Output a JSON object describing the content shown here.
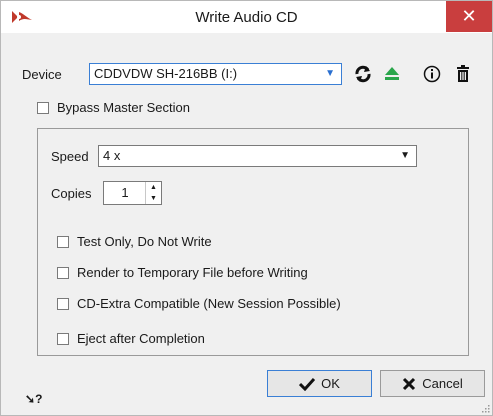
{
  "window": {
    "title": "Write Audio CD",
    "close_label": "✕",
    "accent_color": "#3a7fd5",
    "close_bg": "#c93e3e"
  },
  "device": {
    "label": "Device",
    "selected": "CDDVDW SH-216BB (I:)"
  },
  "icons": [
    "refresh-icon",
    "eject-icon",
    "info-icon",
    "trash-icon"
  ],
  "bypass": {
    "label": "Bypass Master Section",
    "checked": false
  },
  "speed": {
    "label": "Speed",
    "selected": "4 x"
  },
  "copies": {
    "label": "Copies",
    "value": "1"
  },
  "options": [
    {
      "label": "Test Only, Do Not Write",
      "checked": false
    },
    {
      "label": "Render to Temporary File before Writing",
      "checked": false
    },
    {
      "label": "CD-Extra Compatible (New Session Possible)",
      "checked": false
    },
    {
      "label": "Eject after Completion",
      "checked": false
    }
  ],
  "buttons": {
    "ok": "OK",
    "cancel": "Cancel"
  },
  "help": "?"
}
